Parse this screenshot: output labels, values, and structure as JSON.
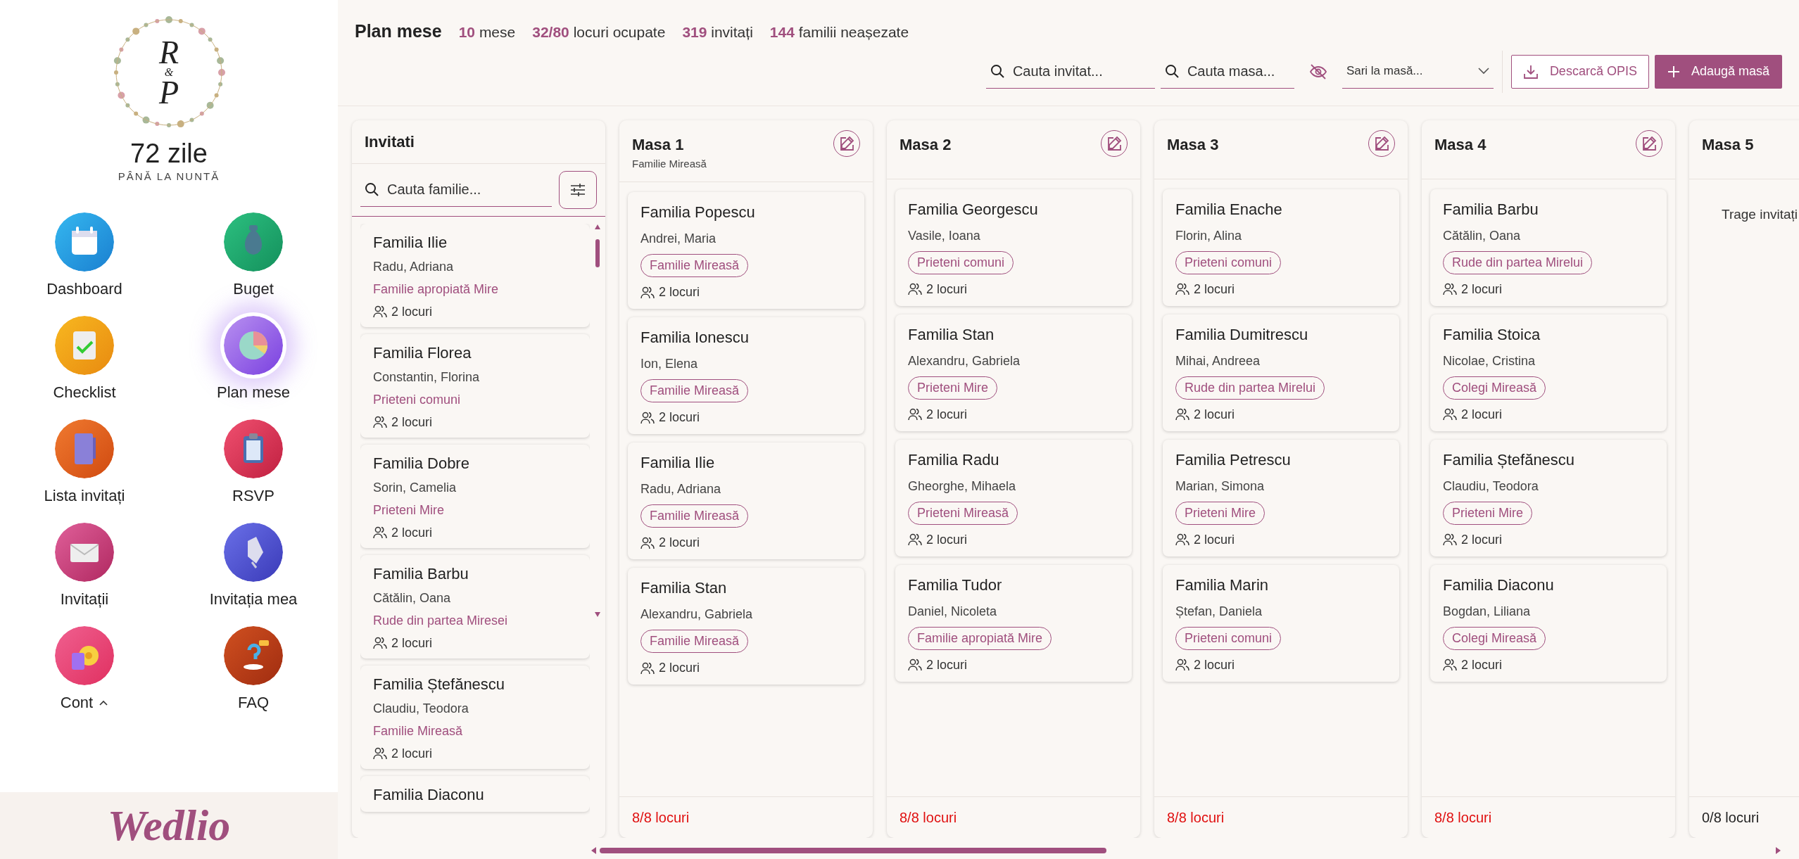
{
  "sidebar": {
    "monogram": [
      "R",
      "&",
      "P"
    ],
    "countdown": "72 zile",
    "countdown_label": "PÂNĂ LA NUNTĂ",
    "items": [
      {
        "label": "Dashboard",
        "selected": false,
        "kind": "link"
      },
      {
        "label": "Buget",
        "selected": false,
        "kind": "link"
      },
      {
        "label": "Checklist",
        "selected": false,
        "kind": "link"
      },
      {
        "label": "Plan mese",
        "selected": true,
        "kind": "link"
      },
      {
        "label": "Lista invitați",
        "selected": false,
        "kind": "link"
      },
      {
        "label": "RSVP",
        "selected": false,
        "kind": "link"
      },
      {
        "label": "Invitații",
        "selected": false,
        "kind": "link"
      },
      {
        "label": "Invitația mea",
        "selected": false,
        "kind": "link"
      },
      {
        "label": "Cont",
        "selected": false,
        "kind": "menu"
      },
      {
        "label": "FAQ",
        "selected": false,
        "kind": "link"
      }
    ],
    "logo": "Wedlio"
  },
  "header": {
    "title": "Plan mese",
    "stats": [
      "**10** mese",
      "**32/80** locuri ocupate",
      "**319** invitați",
      "**144** familii neașezate"
    ]
  },
  "toolbar": {
    "guest_search": {
      "placeholder": "Cauta invitat..."
    },
    "table_search": {
      "placeholder": "Cauta masa..."
    },
    "jump": {
      "placeholder": "Sari la masă..."
    },
    "download_button": "Descarcă OPIS",
    "add_button": "Adaugă masă"
  },
  "guests": {
    "title": "Invitati",
    "search": {
      "placeholder": "Cauta familie..."
    },
    "families": [
      {
        "name": "Familia Ilie",
        "members": "Radu, Adriana",
        "group": "Familie apropiată Mire",
        "seats": "2 locuri"
      },
      {
        "name": "Familia Florea",
        "members": "Constantin, Florina",
        "group": "Prieteni comuni",
        "seats": "2 locuri"
      },
      {
        "name": "Familia Dobre",
        "members": "Sorin, Camelia",
        "group": "Prieteni Mire",
        "seats": "2 locuri"
      },
      {
        "name": "Familia Barbu",
        "members": "Cătălin, Oana",
        "group": "Rude din partea Miresei",
        "seats": "2 locuri"
      },
      {
        "name": "Familia Ștefănescu",
        "members": "Claudiu, Teodora",
        "group": "Familie Mireasă",
        "seats": "2 locuri"
      },
      {
        "name": "Familia Diaconu"
      }
    ]
  },
  "tables": [
    {
      "name": "Masa 1",
      "subtitle": "Familie Mireasă",
      "count": "8/8 locuri",
      "full": true,
      "families": [
        {
          "name": "Familia Popescu",
          "members": "Andrei, Maria",
          "group": "Familie Mireasă",
          "seats": "2 locuri"
        },
        {
          "name": "Familia Ionescu",
          "members": "Ion, Elena",
          "group": "Familie Mireasă",
          "seats": "2 locuri"
        },
        {
          "name": "Familia Ilie",
          "members": "Radu, Adriana",
          "group": "Familie Mireasă",
          "seats": "2 locuri"
        },
        {
          "name": "Familia Stan",
          "members": "Alexandru, Gabriela",
          "group": "Familie Mireasă",
          "seats": "2 locuri"
        }
      ]
    },
    {
      "name": "Masa 2",
      "count": "8/8 locuri",
      "full": true,
      "families": [
        {
          "name": "Familia Georgescu",
          "members": "Vasile, Ioana",
          "group": "Prieteni comuni",
          "seats": "2 locuri"
        },
        {
          "name": "Familia Stan",
          "members": "Alexandru, Gabriela",
          "group": "Prieteni Mire",
          "seats": "2 locuri"
        },
        {
          "name": "Familia Radu",
          "members": "Gheorghe, Mihaela",
          "group": "Prieteni Mireasă",
          "seats": "2 locuri"
        },
        {
          "name": "Familia Tudor",
          "members": "Daniel, Nicoleta",
          "group": "Familie apropiată Mire",
          "seats": "2 locuri"
        }
      ]
    },
    {
      "name": "Masa 3",
      "count": "8/8 locuri",
      "full": true,
      "families": [
        {
          "name": "Familia Enache",
          "members": "Florin, Alina",
          "group": "Prieteni comuni",
          "seats": "2 locuri"
        },
        {
          "name": "Familia Dumitrescu",
          "members": "Mihai, Andreea",
          "group": "Rude din partea Mirelui",
          "seats": "2 locuri"
        },
        {
          "name": "Familia Petrescu",
          "members": "Marian, Simona",
          "group": "Prieteni Mire",
          "seats": "2 locuri"
        },
        {
          "name": "Familia Marin",
          "members": "Ștefan, Daniela",
          "group": "Prieteni comuni",
          "seats": "2 locuri"
        }
      ]
    },
    {
      "name": "Masa 4",
      "count": "8/8 locuri",
      "full": true,
      "families": [
        {
          "name": "Familia Barbu",
          "members": "Cătălin, Oana",
          "group": "Rude din partea Mirelui",
          "seats": "2 locuri"
        },
        {
          "name": "Familia Stoica",
          "members": "Nicolae, Cristina",
          "group": "Colegi Mireasă",
          "seats": "2 locuri"
        },
        {
          "name": "Familia Ștefănescu",
          "members": "Claudiu, Teodora",
          "group": "Prieteni Mire",
          "seats": "2 locuri"
        },
        {
          "name": "Familia Diaconu",
          "members": "Bogdan, Liliana",
          "group": "Colegi Mireasă",
          "seats": "2 locuri"
        }
      ]
    },
    {
      "name": "Masa 5",
      "count": "0/8 locuri",
      "full": false,
      "empty_hint": "Trage invitați"
    }
  ]
}
